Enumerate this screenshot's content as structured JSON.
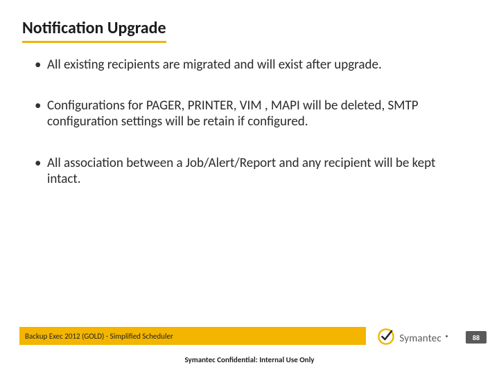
{
  "title": "Notification Upgrade",
  "bullets": {
    "b0": "All existing recipients are migrated and will exist after upgrade.",
    "b1": "Configurations for PAGER, PRINTER, VIM , MAPI will be deleted, SMTP configuration settings will be retain if configured.",
    "b2": "All association between a Job/Alert/Report and any recipient will be kept intact."
  },
  "footer_bar": "Backup Exec 2012 (GOLD) - Simplified Scheduler",
  "brand": "Symantec",
  "page_number": "88",
  "confidential": "Symantec Confidential:  Internal Use Only"
}
